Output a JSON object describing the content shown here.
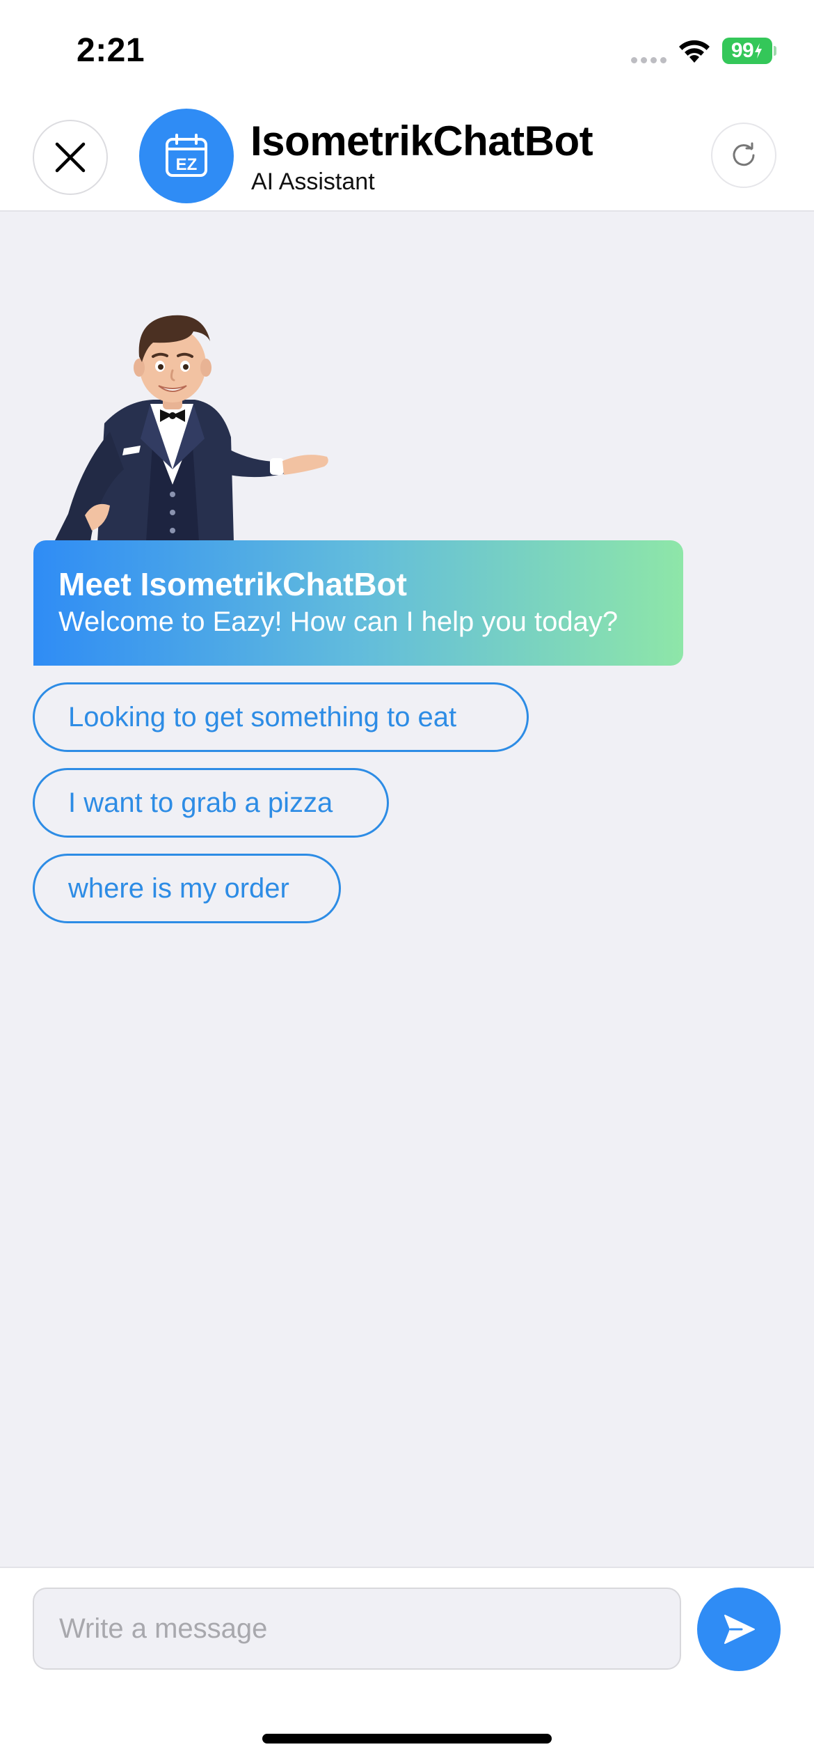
{
  "status_bar": {
    "time": "2:21",
    "battery": "99"
  },
  "header": {
    "title": "IsometrikChatBot",
    "subtitle": "AI Assistant",
    "avatar_label": "EZ"
  },
  "welcome": {
    "title": "Meet IsometrikChatBot",
    "message": "Welcome to Eazy! How can I help you today?"
  },
  "suggestions": [
    "Looking to get something to eat",
    "I want to grab a pizza",
    "where is my order"
  ],
  "composer": {
    "placeholder": "Write a message"
  },
  "colors": {
    "accent": "#2f8cf5",
    "gradient_end": "#8ee6a8",
    "battery": "#34c759",
    "background": "#f0f0f5"
  },
  "icons": {
    "close": "close-icon",
    "refresh": "refresh-icon",
    "send": "send-icon",
    "wifi": "wifi-icon",
    "avatar": "calendar-ez-icon"
  }
}
